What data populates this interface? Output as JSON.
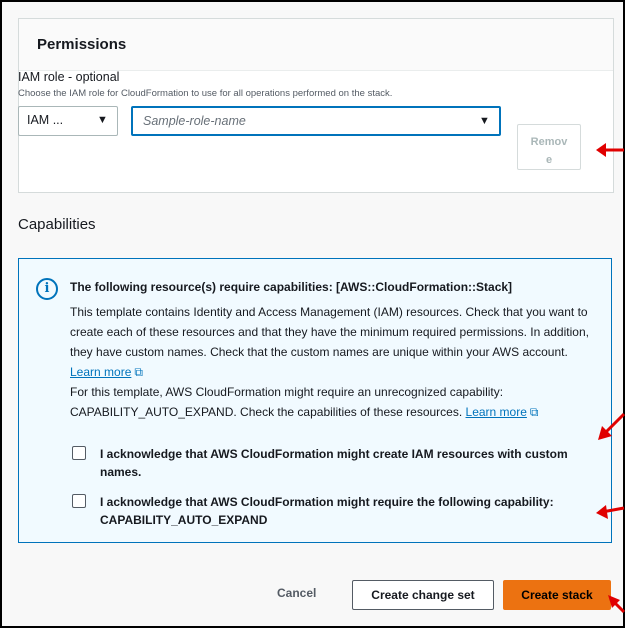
{
  "permissions": {
    "title": "Permissions",
    "iam_label": "IAM role - optional",
    "iam_description": "Choose the IAM role for CloudFormation to use for all operations performed on the stack.",
    "iam_type_value": "IAM ...",
    "role_placeholder": "Sample-role-name",
    "remove_label_line1": "Remov",
    "remove_label_line2": "e"
  },
  "capabilities": {
    "title": "Capabilities",
    "info_heading": "The following resource(s) require capabilities: [AWS::CloudFormation::Stack]",
    "paragraph1": "This template contains Identity and Access Management (IAM) resources. Check that you want to create each of these resources and that they have the minimum required permissions. In addition, they have custom names. Check that the custom names are unique within your AWS account.",
    "paragraph2": "For this template, AWS CloudFormation might require an unrecognized capability: CAPABILITY_AUTO_EXPAND. Check the capabilities of these resources.",
    "learn_more": "Learn more",
    "ack_iam": "I acknowledge that AWS CloudFormation might create IAM resources with custom names.",
    "ack_auto_expand": "I acknowledge that AWS CloudFormation might require the following capability: CAPABILITY_AUTO_EXPAND"
  },
  "footer": {
    "cancel": "Cancel",
    "create_change_set": "Create change set",
    "create_stack": "Create stack"
  },
  "colors": {
    "accent": "#0073bb",
    "primary_button": "#ec7211",
    "annotation_arrow": "#e00000"
  }
}
